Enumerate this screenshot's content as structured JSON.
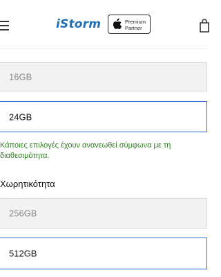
{
  "header": {
    "logo_text": "iStorm",
    "partner_line1": "Premium",
    "partner_line2": "Partner"
  },
  "memory_options": [
    {
      "label": "16GB",
      "state": "disabled"
    },
    {
      "label": "24GB",
      "state": "selected"
    }
  ],
  "notice": "Κάποιες επιλογές έχουν ανανεωθεί σύμφωνα με τη διαθεσιμότητα.",
  "storage": {
    "title": "Χωρητικότητα",
    "options": [
      {
        "label": "256GB",
        "state": "disabled"
      },
      {
        "label": "512GB",
        "state": "selected"
      }
    ]
  },
  "colors": {
    "brand": "#1f6fb3",
    "selected_border": "#2f6dd5",
    "notice": "#2f7d22"
  }
}
